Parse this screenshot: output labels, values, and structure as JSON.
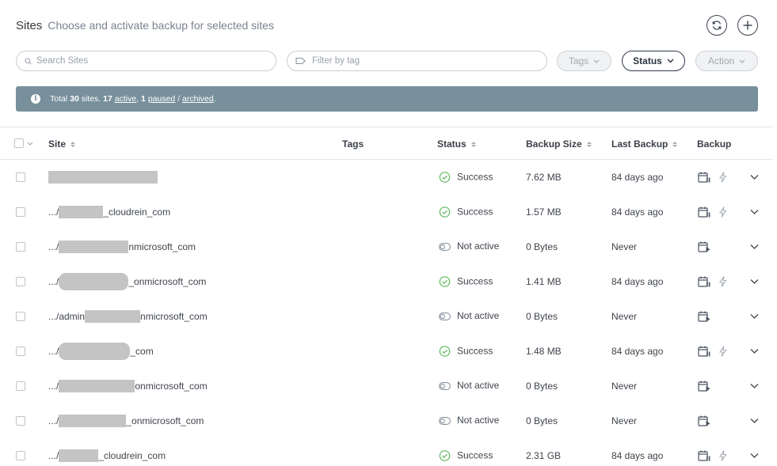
{
  "header": {
    "title": "Sites",
    "subtitle": "Choose and activate backup for selected sites"
  },
  "toolbar": {
    "search_placeholder": "Search Sites",
    "tag_placeholder": "Filter by tag",
    "tags_label": "Tags",
    "status_label": "Status",
    "action_label": "Action"
  },
  "banner": {
    "prefix": "Total",
    "total": "30",
    "sites_word": "sites.",
    "active_count": "17",
    "active_label": "active",
    "paused_count": "1",
    "paused_label": "paused",
    "separator": "/",
    "archived_label": "archived",
    "end": "."
  },
  "table": {
    "columns": {
      "site": "Site",
      "tags": "Tags",
      "status": "Status",
      "backup_size": "Backup Size",
      "last_backup": "Last Backup",
      "backup": "Backup"
    },
    "rows": [
      {
        "site_prefix": "",
        "site_suffix": "",
        "status": "Success",
        "size": "7.62 MB",
        "last": "84 days ago"
      },
      {
        "site_prefix": ".../",
        "site_suffix": "_cloudrein_com",
        "status": "Success",
        "size": "1.57 MB",
        "last": "84 days ago"
      },
      {
        "site_prefix": ".../",
        "site_suffix": "nmicrosoft_com",
        "status": "Not active",
        "size": "0 Bytes",
        "last": "Never"
      },
      {
        "site_prefix": ".../",
        "site_suffix": "_onmicrosoft_com",
        "status": "Success",
        "size": "1.41 MB",
        "last": "84 days ago"
      },
      {
        "site_prefix": ".../admin",
        "site_suffix": "nmicrosoft_com",
        "status": "Not active",
        "size": "0 Bytes",
        "last": "Never"
      },
      {
        "site_prefix": ".../",
        "site_suffix": "_com",
        "status": "Success",
        "size": "1.48 MB",
        "last": "84 days ago"
      },
      {
        "site_prefix": ".../",
        "site_suffix": "onmicrosoft_com",
        "status": "Not active",
        "size": "0 Bytes",
        "last": "Never"
      },
      {
        "site_prefix": ".../",
        "site_suffix": "_onmicrosoft_com",
        "status": "Not active",
        "size": "0 Bytes",
        "last": "Never"
      },
      {
        "site_prefix": ".../",
        "site_suffix": "_cloudrein_com",
        "status": "Success",
        "size": "2.31 GB",
        "last": "84 days ago"
      }
    ]
  },
  "icons": {
    "refresh": "refresh-icon",
    "add": "plus-icon",
    "search": "search-icon",
    "tag": "tag-icon",
    "info": "info-icon",
    "success": "check-circle-icon",
    "not_active": "toggle-off-icon",
    "schedule_paused": "calendar-pause-icon",
    "schedule_play": "calendar-play-icon",
    "instant": "lightning-icon",
    "expand": "chevron-down-icon"
  },
  "colors": {
    "banner": "#78909c",
    "success": "#5cb85c",
    "inactive": "#8a94a0",
    "accent": "#2f3a4a"
  }
}
